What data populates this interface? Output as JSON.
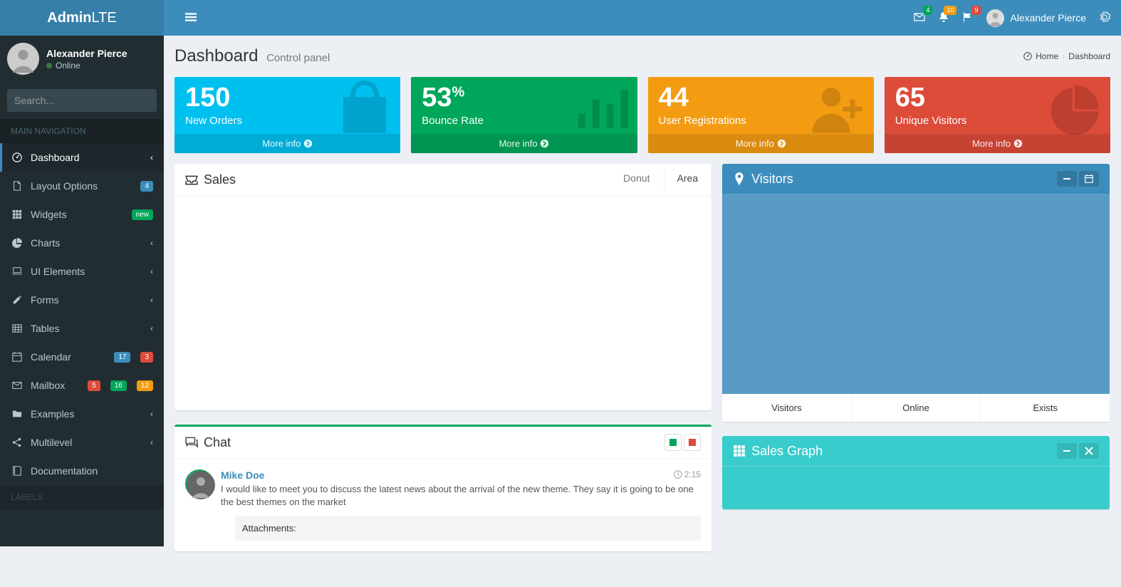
{
  "brand": {
    "bold": "Admin",
    "light": "LTE"
  },
  "topbar": {
    "user_name": "Alexander Pierce",
    "badges": {
      "messages": "4",
      "notifications": "10",
      "tasks": "9"
    }
  },
  "sidebar": {
    "user_name": "Alexander Pierce",
    "user_status": "Online",
    "search_placeholder": "Search...",
    "header": "MAIN NAVIGATION",
    "labels_header": "LABELS",
    "items": {
      "dashboard": "Dashboard",
      "layout": "Layout Options",
      "layout_badge": "4",
      "widgets": "Widgets",
      "widgets_badge": "new",
      "charts": "Charts",
      "ui": "UI Elements",
      "forms": "Forms",
      "tables": "Tables",
      "calendar": "Calendar",
      "calendar_badge1": "17",
      "calendar_badge2": "3",
      "mailbox": "Mailbox",
      "mailbox_badge1": "5",
      "mailbox_badge2": "16",
      "mailbox_badge3": "12",
      "examples": "Examples",
      "multilevel": "Multilevel",
      "documentation": "Documentation"
    }
  },
  "page": {
    "title": "Dashboard",
    "subtitle": "Control panel",
    "breadcrumb_home": "Home",
    "breadcrumb_current": "Dashboard"
  },
  "stats": {
    "new_orders": {
      "value": "150",
      "label": "New Orders",
      "more": "More info"
    },
    "bounce": {
      "value": "53",
      "suffix": "%",
      "label": "Bounce Rate",
      "more": "More info"
    },
    "user_reg": {
      "value": "44",
      "label": "User Registrations",
      "more": "More info"
    },
    "visitors": {
      "value": "65",
      "label": "Unique Visitors",
      "more": "More info"
    }
  },
  "sales_box": {
    "title": "Sales",
    "tab_donut": "Donut",
    "tab_area": "Area"
  },
  "visitors_box": {
    "title": "Visitors",
    "footer1": "Visitors",
    "footer2": "Online",
    "footer3": "Exists"
  },
  "sales_graph": {
    "title": "Sales Graph"
  },
  "chat": {
    "title": "Chat",
    "msg_name": "Mike Doe",
    "msg_time": "2:15",
    "msg_body": "I would like to meet you to discuss the latest news about the arrival of the new theme. They say it is going to be one the best themes on the market",
    "attachments_label": "Attachments:"
  }
}
